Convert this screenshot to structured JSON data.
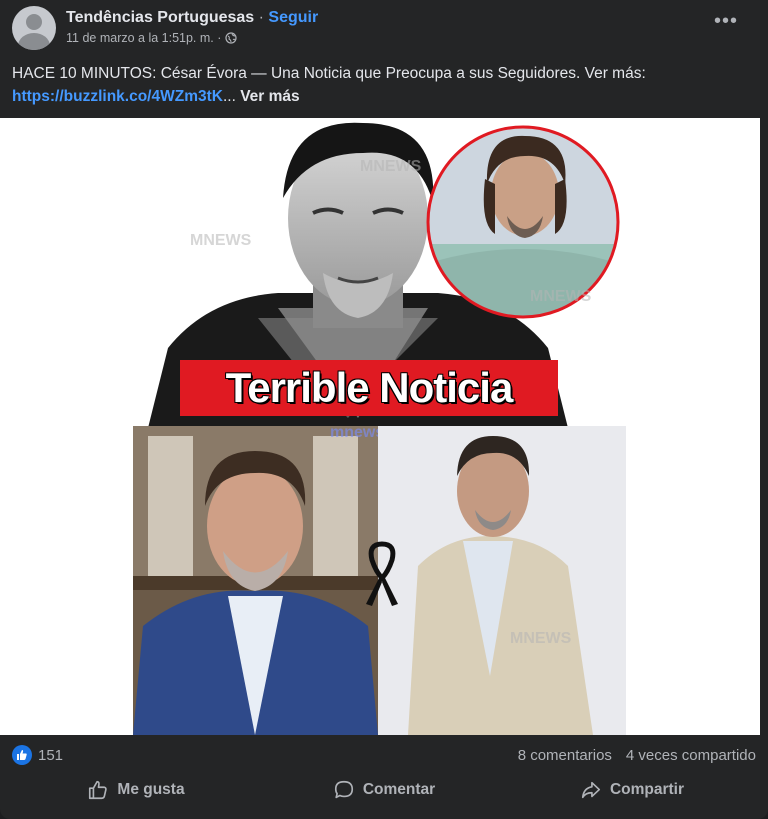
{
  "post": {
    "page_name": "Tendências Portuguesas",
    "separator": " · ",
    "follow_label": "Seguir",
    "timestamp": "11 de marzo a la 1:51p. m. ·",
    "privacy_icon": "globe-icon",
    "more_icon": "more-options-icon",
    "text_main": "HACE 10 MINUTOS: César Évora — Una Noticia que Preocupa a sus Seguidores. Ver más:",
    "link_text": "https://buzzlink.co/4WZm3tK",
    "ellipsis": "...",
    "see_more_label": "Ver más"
  },
  "image": {
    "banner_text": "Terrible Noticia",
    "watermarks": [
      "MNEWS",
      "MNEWS",
      "mnews",
      "MNEWS",
      "MNEWS"
    ],
    "colors": {
      "banner": "#e01a22",
      "circle_border": "#e01a22"
    }
  },
  "stats": {
    "reaction_icon": "like-reaction-icon",
    "reaction_count": "151",
    "comments": "8 comentarios",
    "shares": "4 veces compartido"
  },
  "actions": [
    {
      "label": "Me gusta",
      "icon": "thumbs-up-icon"
    },
    {
      "label": "Comentar",
      "icon": "comment-icon"
    },
    {
      "label": "Compartir",
      "icon": "share-icon"
    }
  ],
  "theme": {
    "accent": "#4599ff",
    "card_bg": "#242526",
    "text": "#e4e6eb",
    "muted": "#b0b3b8"
  }
}
